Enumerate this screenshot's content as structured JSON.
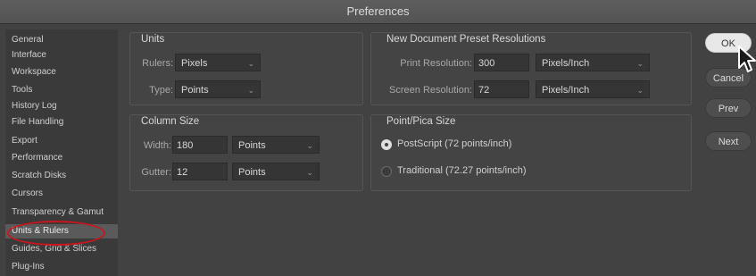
{
  "window": {
    "title": "Preferences"
  },
  "sidebar": {
    "items": [
      {
        "label": "General"
      },
      {
        "label": "Interface"
      },
      {
        "label": "Workspace"
      },
      {
        "label": "Tools"
      },
      {
        "label": "History Log"
      },
      {
        "label": "File Handling"
      },
      {
        "label": "Export"
      },
      {
        "label": "Performance"
      },
      {
        "label": "Scratch Disks"
      },
      {
        "label": "Cursors"
      },
      {
        "label": "Transparency & Gamut"
      },
      {
        "label": "Units & Rulers"
      },
      {
        "label": "Guides, Grid & Slices"
      },
      {
        "label": "Plug-Ins"
      }
    ],
    "selected": "Units & Rulers",
    "highlight_color": "#c8161d"
  },
  "units": {
    "title": "Units",
    "rulers_label": "Rulers:",
    "rulers_value": "Pixels",
    "type_label": "Type:",
    "type_value": "Points"
  },
  "column_size": {
    "title": "Column Size",
    "width_label": "Width:",
    "width_value": "180",
    "width_unit": "Points",
    "gutter_label": "Gutter:",
    "gutter_value": "12",
    "gutter_unit": "Points"
  },
  "resolutions": {
    "title": "New Document Preset Resolutions",
    "print_label": "Print Resolution:",
    "print_value": "300",
    "print_unit": "Pixels/Inch",
    "screen_label": "Screen Resolution:",
    "screen_value": "72",
    "screen_unit": "Pixels/Inch"
  },
  "point_pica": {
    "title": "Point/Pica Size",
    "options": [
      {
        "label": "PostScript (72 points/inch)",
        "selected": true
      },
      {
        "label": "Traditional (72.27 points/inch)",
        "selected": false
      }
    ]
  },
  "buttons": {
    "ok": "OK",
    "cancel": "Cancel",
    "prev": "Prev",
    "next": "Next"
  },
  "icons": {
    "dropdown": "chevron-down-icon",
    "pointer": "mouse-pointer-icon"
  }
}
